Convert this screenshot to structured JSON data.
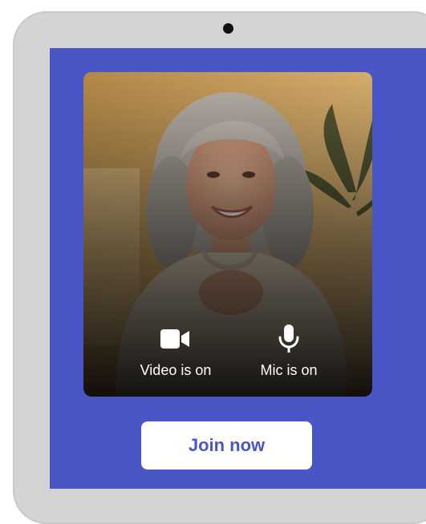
{
  "device": {
    "frame_color": "#d4d4d4",
    "screen_color": "#4a55c6"
  },
  "preview": {
    "video_status_label": "Video is on",
    "mic_status_label": "Mic is on",
    "video_icon": "video-camera-icon",
    "mic_icon": "microphone-icon"
  },
  "actions": {
    "join_label": "Join now"
  }
}
